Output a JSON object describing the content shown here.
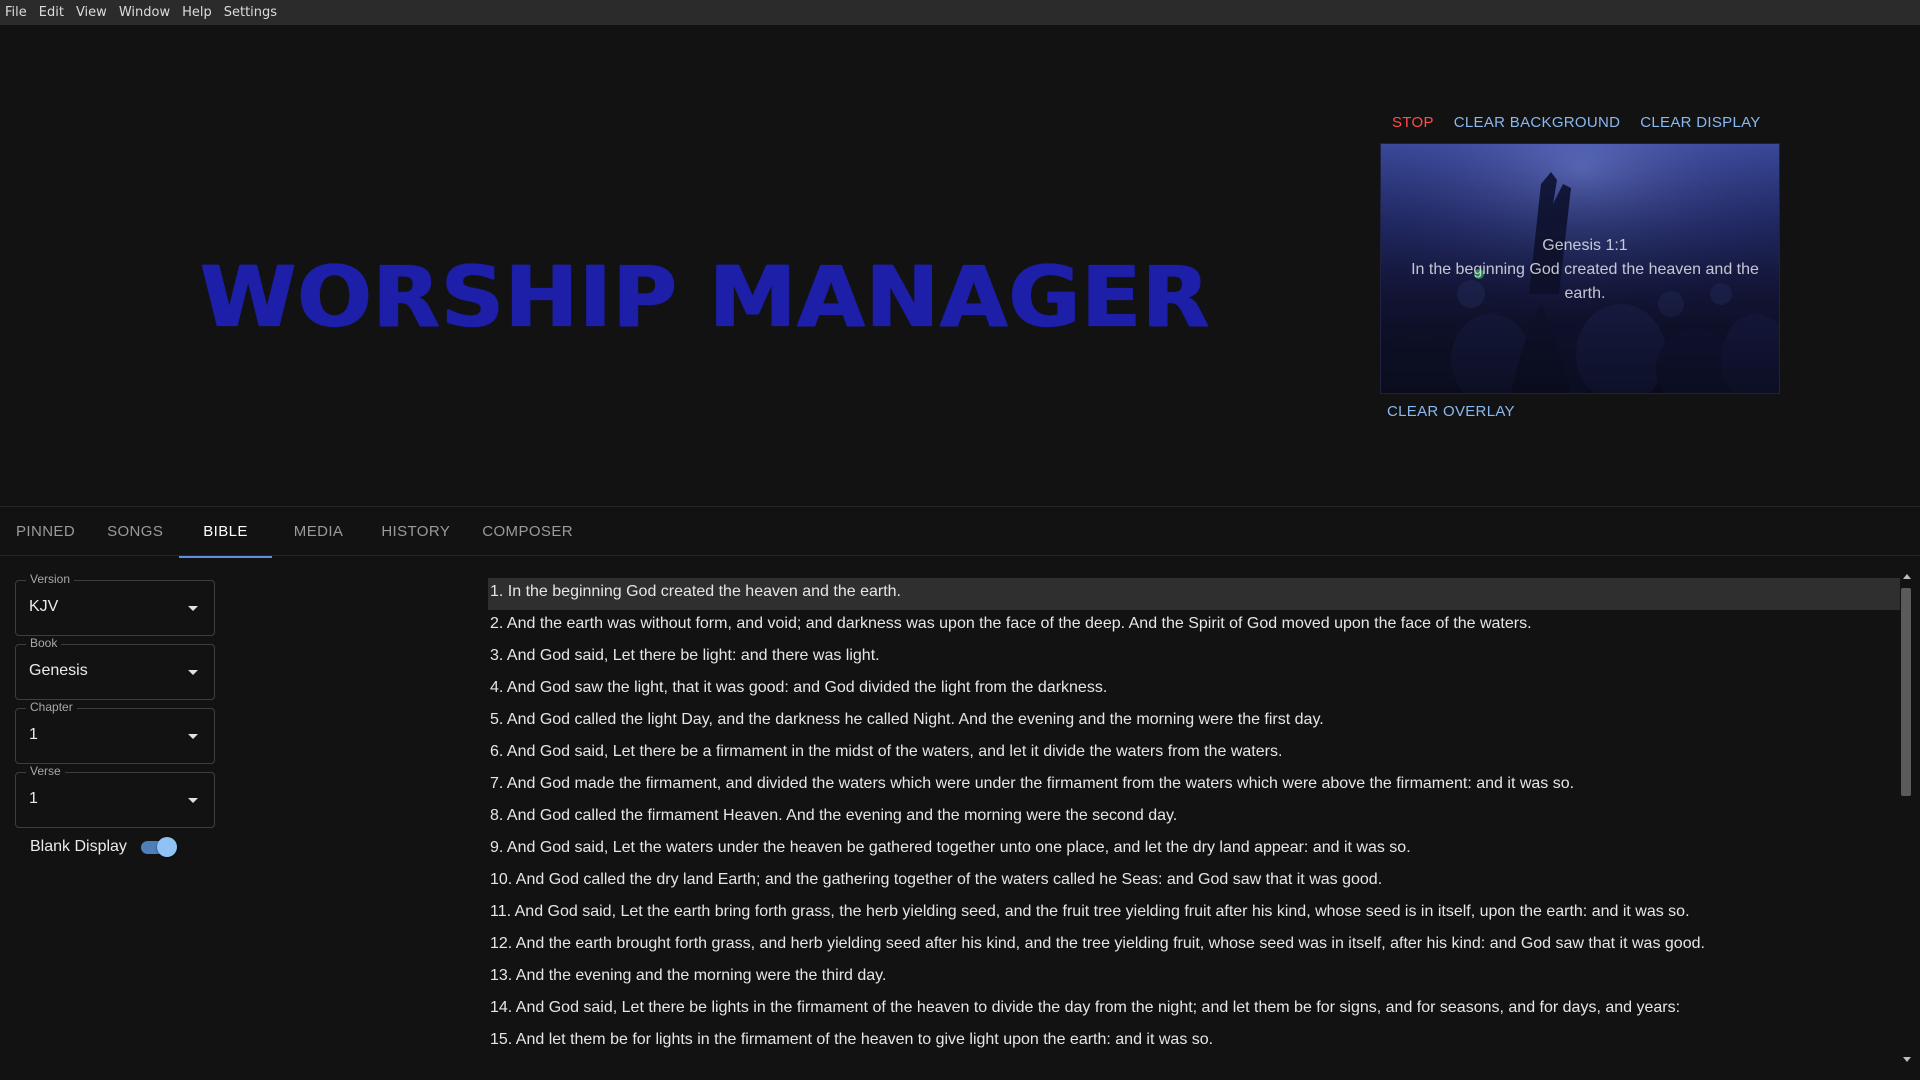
{
  "menu": [
    "File",
    "Edit",
    "View",
    "Window",
    "Help",
    "Settings"
  ],
  "logo_text": "WORSHIP MANAGER",
  "preview": {
    "actions": {
      "stop": "STOP",
      "clear_background": "CLEAR BACKGROUND",
      "clear_display": "CLEAR DISPLAY"
    },
    "reference": "Genesis 1:1",
    "text": "In the beginning God created the heaven and the earth.",
    "clear_overlay": "CLEAR OVERLAY"
  },
  "tabs": [
    {
      "label": "PINNED",
      "active": false
    },
    {
      "label": "SONGS",
      "active": false
    },
    {
      "label": "BIBLE",
      "active": true
    },
    {
      "label": "MEDIA",
      "active": false
    },
    {
      "label": "HISTORY",
      "active": false
    },
    {
      "label": "COMPOSER",
      "active": false
    }
  ],
  "selectors": {
    "version": {
      "label": "Version",
      "value": "KJV"
    },
    "book": {
      "label": "Book",
      "value": "Genesis"
    },
    "chapter": {
      "label": "Chapter",
      "value": "1"
    },
    "verse": {
      "label": "Verse",
      "value": "1"
    }
  },
  "blank_display": {
    "label": "Blank Display",
    "enabled": true
  },
  "verses": [
    "1. In the beginning God created the heaven and the earth.",
    "2. And the earth was without form, and void; and darkness was upon the face of the deep. And the Spirit of God moved upon the face of the waters.",
    "3. And God said, Let there be light: and there was light.",
    "4. And God saw the light, that it was good: and God divided the light from the darkness.",
    "5. And God called the light Day, and the darkness he called Night. And the evening and the morning were the first day.",
    "6. And God said, Let there be a firmament in the midst of the waters, and let it divide the waters from the waters.",
    "7. And God made the firmament, and divided the waters which were under the firmament from the waters which were above the firmament: and it was so.",
    "8. And God called the firmament Heaven. And the evening and the morning were the second day.",
    "9. And God said, Let the waters under the heaven be gathered together unto one place, and let the dry land appear: and it was so.",
    "10. And God called the dry land Earth; and the gathering together of the waters called he Seas: and God saw that it was good.",
    "11. And God said, Let the earth bring forth grass, the herb yielding seed, and the fruit tree yielding fruit after his kind, whose seed is in itself, upon the earth: and it was so.",
    "12. And the earth brought forth grass, and herb yielding seed after his kind, and the tree yielding fruit, whose seed was in itself, after his kind: and God saw that it was good.",
    "13. And the evening and the morning were the third day.",
    "14. And God said, Let there be lights in the firmament of the heaven to divide the day from the night; and let them be for signs, and for seasons, and for days, and years:",
    "15. And let them be for lights in the firmament of the heaven to give light upon the earth: and it was so."
  ],
  "selected_verse_index": 0,
  "colors": {
    "accent": "#5f8fe0",
    "stop": "#ff4d4d",
    "link": "#8ab8f0",
    "logo": "#1d1fa8"
  }
}
